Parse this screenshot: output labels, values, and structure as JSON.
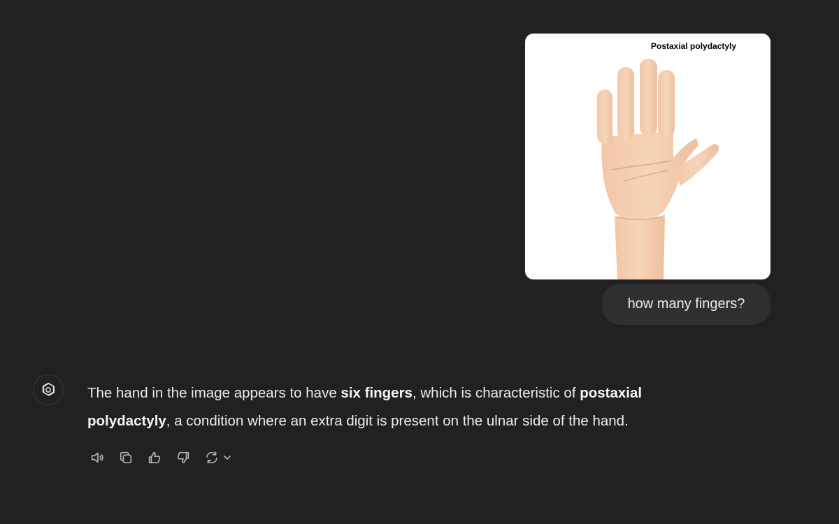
{
  "attachment": {
    "caption": "Postaxial polydactyly"
  },
  "user_message": {
    "text": "how many fingers?"
  },
  "assistant_message": {
    "segments": [
      {
        "text": "The hand in the image appears to have ",
        "bold": false
      },
      {
        "text": "six fingers",
        "bold": true
      },
      {
        "text": ", which is characteristic of ",
        "bold": false
      },
      {
        "text": "postaxial polydactyly",
        "bold": true
      },
      {
        "text": ", a condition where an extra digit is present on the ulnar side of the hand.",
        "bold": false
      }
    ]
  },
  "actions": [
    {
      "name": "read-aloud-button",
      "icon": "speaker-icon"
    },
    {
      "name": "copy-button",
      "icon": "copy-icon"
    },
    {
      "name": "thumbs-up-button",
      "icon": "thumbs-up-icon"
    },
    {
      "name": "thumbs-down-button",
      "icon": "thumbs-down-icon"
    },
    {
      "name": "regenerate-button",
      "icon": "refresh-icon"
    }
  ],
  "colors": {
    "background": "#212121",
    "user_bubble": "#2f2f2f",
    "text": "#ececec"
  }
}
